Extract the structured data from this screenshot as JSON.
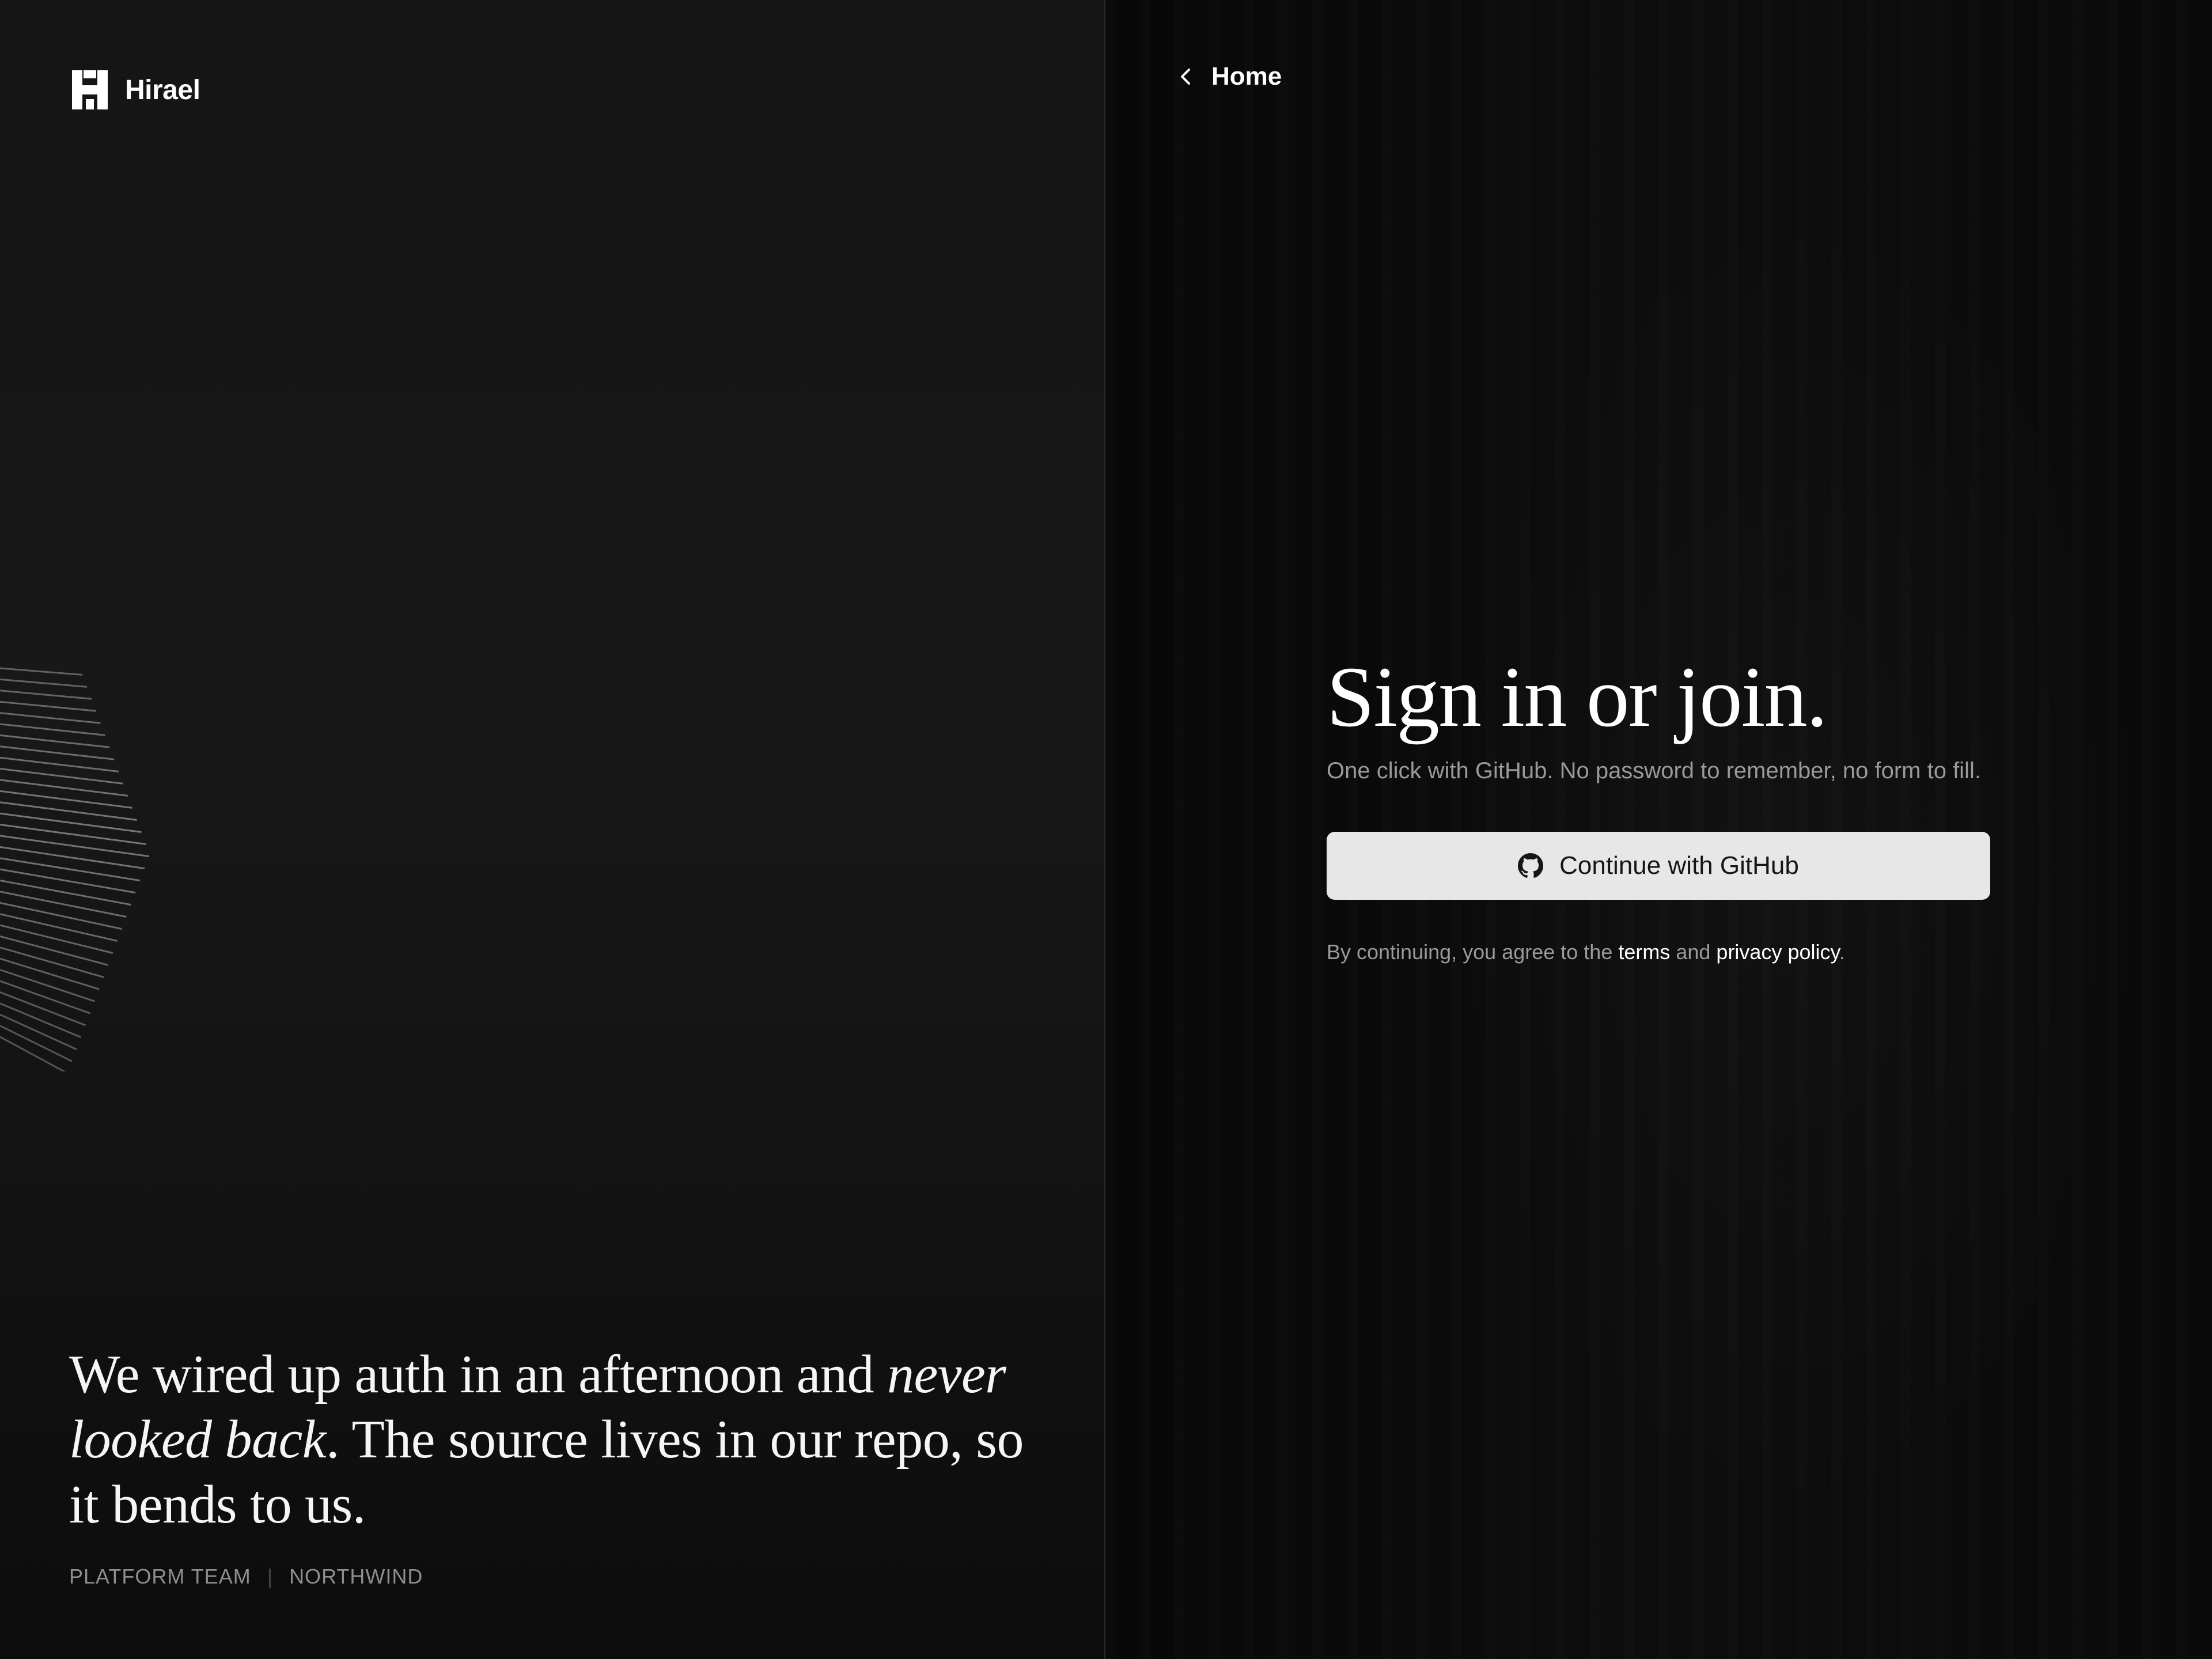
{
  "brand": {
    "name": "Hirael",
    "icon": "hirael-logo-icon"
  },
  "nav": {
    "home_label": "Home",
    "back_icon": "chevron-left-icon"
  },
  "testimonial": {
    "part1": "We wired up auth in an afternoon and ",
    "emphasis": "never looked back",
    "part2": ". The source lives in our repo, so it bends to us.",
    "team": "PLATFORM TEAM",
    "separator": "|",
    "company": "NORTHWIND"
  },
  "auth": {
    "title": "Sign in or join.",
    "subtitle": "One click with GitHub. No password to remember, no form to fill.",
    "github_button_label": "Continue with GitHub",
    "github_icon": "github-icon",
    "legal_prefix": "By continuing, you agree to the ",
    "terms_label": "terms",
    "legal_and": " and ",
    "privacy_label": "privacy policy",
    "legal_suffix": "."
  },
  "colors": {
    "left_bg": "#181818",
    "right_bg": "#0b0b0b",
    "button_bg": "#e7e7e7",
    "muted_text": "#9a9a9a",
    "text": "#ffffff"
  }
}
